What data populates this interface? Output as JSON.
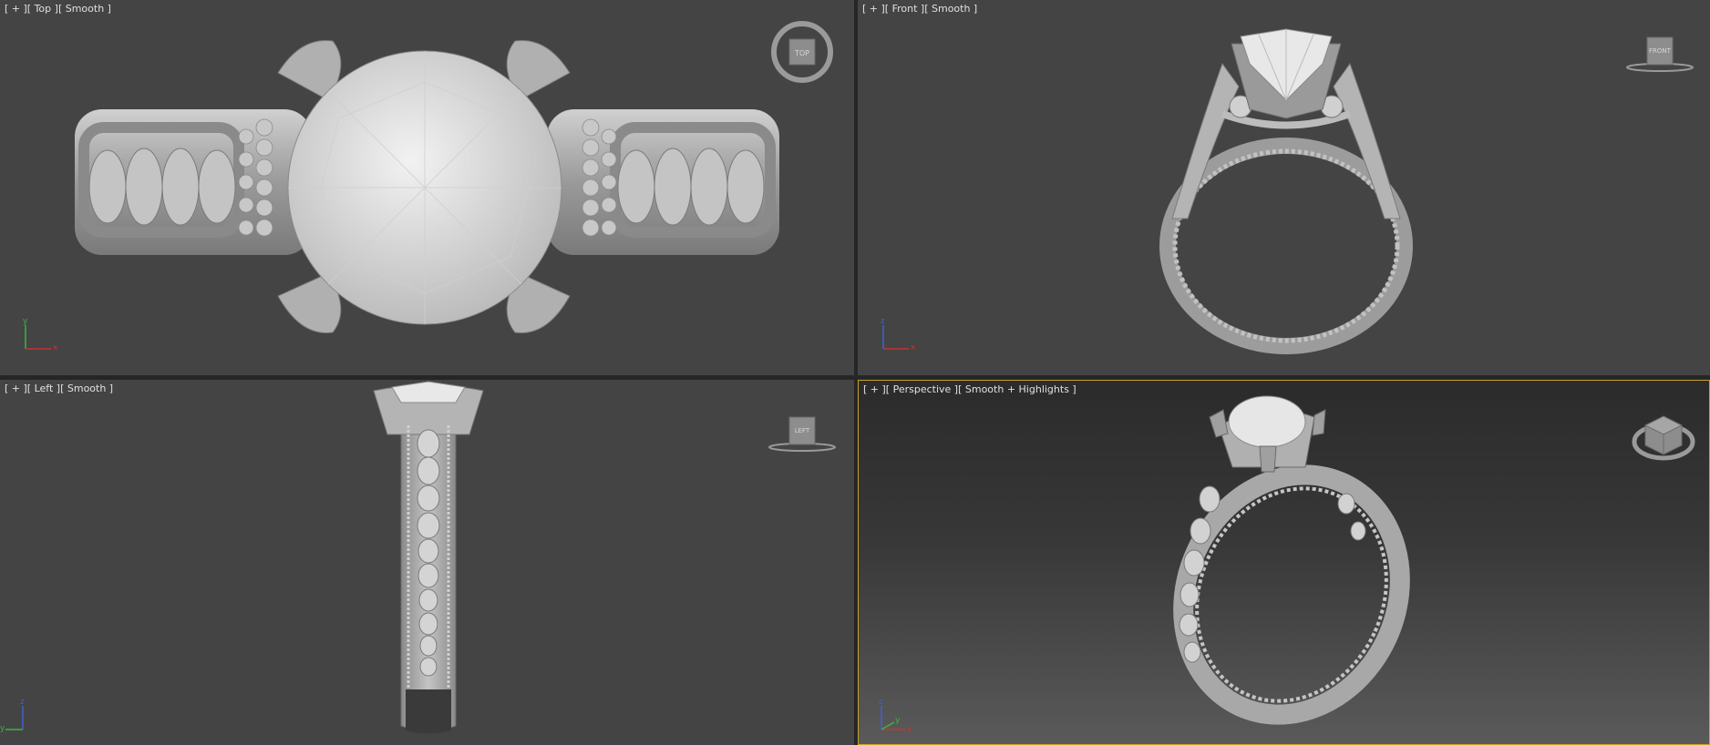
{
  "viewports": {
    "top": {
      "plus": "[ + ]",
      "view": "[ Top ]",
      "shading": "[ Smooth ]",
      "cube_label": "TOP"
    },
    "front": {
      "plus": "[ + ]",
      "view": "[ Front ]",
      "shading": "[ Smooth ]",
      "cube_label": "FRONT"
    },
    "left": {
      "plus": "[ + ]",
      "view": "[ Left ]",
      "shading": "[ Smooth ]",
      "cube_label": "LEFT"
    },
    "perspective": {
      "plus": "[ + ]",
      "view": "[ Perspective ]",
      "shading": "[ Smooth + Highlights ]",
      "cube_label": ""
    }
  },
  "axes": {
    "top": {
      "v": "y",
      "h": "x"
    },
    "front": {
      "v": "z",
      "h": "x"
    },
    "left": {
      "v": "z",
      "h": "y"
    },
    "perspective": {
      "v": "z",
      "h": "x",
      "d": "y"
    }
  },
  "colors": {
    "viewport_bg": "#444444",
    "active_border": "#c9a227",
    "model": "#bdbdbd",
    "axis_x": "#c83232",
    "axis_y": "#3cb43c",
    "axis_z": "#4060d0"
  },
  "icons": {
    "viewcube": "viewcube-icon",
    "axis_tripod": "axis-tripod-icon",
    "model": "ring-model"
  }
}
